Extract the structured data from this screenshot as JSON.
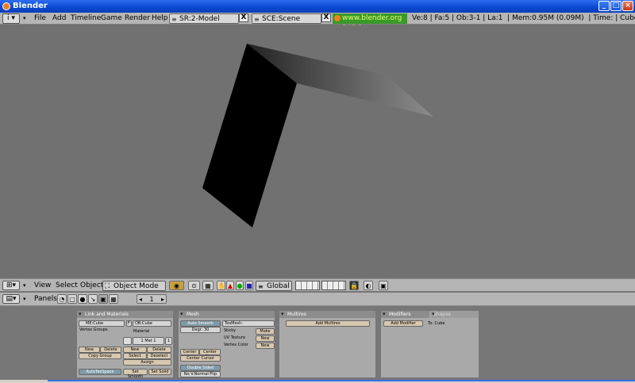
{
  "window": {
    "title": "Blender"
  },
  "topbar": {
    "menus": [
      "File",
      "Add",
      "Timeline",
      "Game",
      "Render",
      "Help"
    ],
    "screen_field": "SR:2-Model",
    "scene_field": "SCE:Scene",
    "url": "www.blender.org 249.2",
    "stats": "Ve:8 | Fa:5 | Ob:3-1 | La:1  | Mem:0.95M (0.09M)  | Time: | Cube"
  },
  "view_header": {
    "menus": [
      "View",
      "Select",
      "Object"
    ],
    "mode": "Object Mode",
    "orientation": "Global"
  },
  "panel_bar": {
    "label": "Panels",
    "page": "1"
  },
  "panels": {
    "link": {
      "title": "Link and Materials",
      "me": "ME:Cube",
      "f": "F",
      "ob": "OB:Cube",
      "vertex_groups": "Vertex Groups",
      "material": "Material",
      "mat_value": "1 Mat 1",
      "mat_right": "1",
      "new": "New",
      "delete": "Delete",
      "copy_group": "Copy Group",
      "new2": "New",
      "delete2": "Delete",
      "select": "Select",
      "deselect": "Deselect",
      "assign": "Assign",
      "autotexspace": "AutoTexSpace",
      "set_smooth": "Set Smooth",
      "set_solid": "Set Solid"
    },
    "mesh": {
      "title": "Mesh",
      "auto_smooth": "Auto Smooth",
      "degr": "Degr: 30",
      "texmesh": "TexMesh:",
      "sticky": "Sticky",
      "make": "Make",
      "uv_texture": "UV Texture",
      "new_uv": "New",
      "vertex_color": "Vertex Color",
      "new_vc": "New",
      "center_new": "Center New",
      "center": "Center",
      "center_cursor": "Center Cursor",
      "double_sided": "Double Sided",
      "no_v_normal_flip": "No V.Normal Flip"
    },
    "multires": {
      "title": "Multires",
      "add": "Add Multires"
    },
    "modifiers": {
      "tab_active": "Modifiers",
      "tab_inactive": "Shapes",
      "add": "Add Modifier",
      "to": "To: Cube"
    }
  }
}
